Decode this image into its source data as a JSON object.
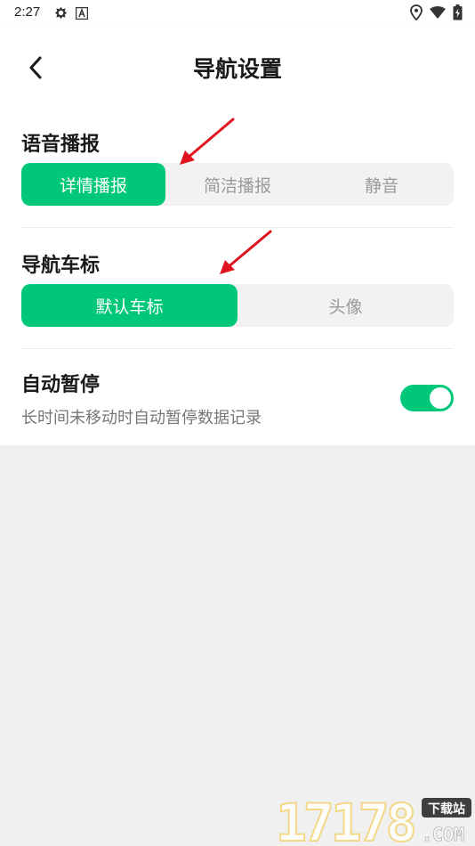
{
  "status_bar": {
    "time": "2:27",
    "left_icons": [
      "settings-gear-icon",
      "text-a-icon"
    ],
    "right_icons": [
      "location-pin-icon",
      "wifi-icon",
      "battery-charging-icon"
    ]
  },
  "header": {
    "title": "导航设置",
    "back_icon": "chevron-left-icon"
  },
  "voice_section": {
    "title": "语音播报",
    "options": [
      "详情播报",
      "简洁播报",
      "静音"
    ],
    "selected_index": 0
  },
  "marker_section": {
    "title": "导航车标",
    "options": [
      "默认车标",
      "头像"
    ],
    "selected_index": 0
  },
  "auto_pause": {
    "title": "自动暂停",
    "description": "长时间未移动时自动暂停数据记录",
    "enabled": true
  },
  "watermark": {
    "number": "17178",
    "badge": "下载站",
    "domain": ".COM"
  },
  "colors": {
    "accent": "#00c878",
    "annotation_arrow": "#e0141e",
    "page_background": "#f0f0f0"
  }
}
